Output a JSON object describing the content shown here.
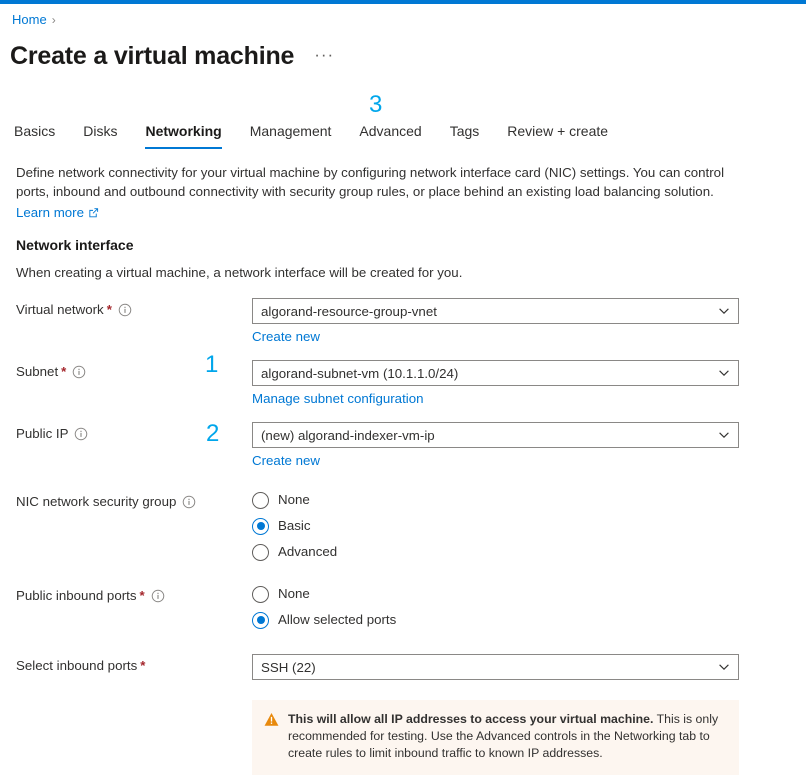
{
  "theme": {
    "accent": "#0078d4",
    "annotation_color": "#00a6eb",
    "required_color": "#a4262c",
    "warning_bg": "#fdf6f0",
    "warning_icon_color": "#e8890c"
  },
  "breadcrumb": {
    "home_label": "Home",
    "separator": "›"
  },
  "header": {
    "title": "Create a virtual machine",
    "ellipsis_label": "···"
  },
  "annotations": [
    {
      "id": "anno-3",
      "label": "3"
    },
    {
      "id": "anno-1",
      "label": "1"
    },
    {
      "id": "anno-2",
      "label": "2"
    }
  ],
  "tabs": [
    {
      "label": "Basics",
      "active": false
    },
    {
      "label": "Disks",
      "active": false
    },
    {
      "label": "Networking",
      "active": true
    },
    {
      "label": "Management",
      "active": false
    },
    {
      "label": "Advanced",
      "active": false
    },
    {
      "label": "Tags",
      "active": false
    },
    {
      "label": "Review + create",
      "active": false
    }
  ],
  "intro": {
    "paragraph": "Define network connectivity for your virtual machine by configuring network interface card (NIC) settings. You can control ports, inbound and outbound connectivity with security group rules, or place behind an existing load balancing solution.",
    "learn_more_label": "Learn more",
    "external_icon": "external-link-icon"
  },
  "section": {
    "heading": "Network interface",
    "description": "When creating a virtual machine, a network interface will be created for you."
  },
  "fields": {
    "virtual_network": {
      "label": "Virtual network",
      "required": true,
      "info_icon": "info-icon",
      "value": "algorand-resource-group-vnet",
      "sublink": "Create new"
    },
    "subnet": {
      "label": "Subnet",
      "required": true,
      "info_icon": "info-icon",
      "value": "algorand-subnet-vm (10.1.1.0/24)",
      "sublink": "Manage subnet configuration"
    },
    "public_ip": {
      "label": "Public IP",
      "required": false,
      "info_icon": "info-icon",
      "value": "(new) algorand-indexer-vm-ip",
      "sublink": "Create new"
    },
    "nic_nsg": {
      "label": "NIC network security group",
      "required": false,
      "info_icon": "info-icon",
      "options": [
        {
          "label": "None",
          "selected": false
        },
        {
          "label": "Basic",
          "selected": true
        },
        {
          "label": "Advanced",
          "selected": false
        }
      ]
    },
    "public_inbound_ports": {
      "label": "Public inbound ports",
      "required": true,
      "info_icon": "info-icon",
      "options": [
        {
          "label": "None",
          "selected": false
        },
        {
          "label": "Allow selected ports",
          "selected": true
        }
      ]
    },
    "select_inbound_ports": {
      "label": "Select inbound ports",
      "required": true,
      "value": "SSH (22)"
    }
  },
  "warning": {
    "icon": "warning-triangle-icon",
    "bold_text": "This will allow all IP addresses to access your virtual machine.",
    "body_text": " This is only recommended for testing.  Use the Advanced controls in the Networking tab to create rules to limit inbound traffic to known IP addresses."
  }
}
